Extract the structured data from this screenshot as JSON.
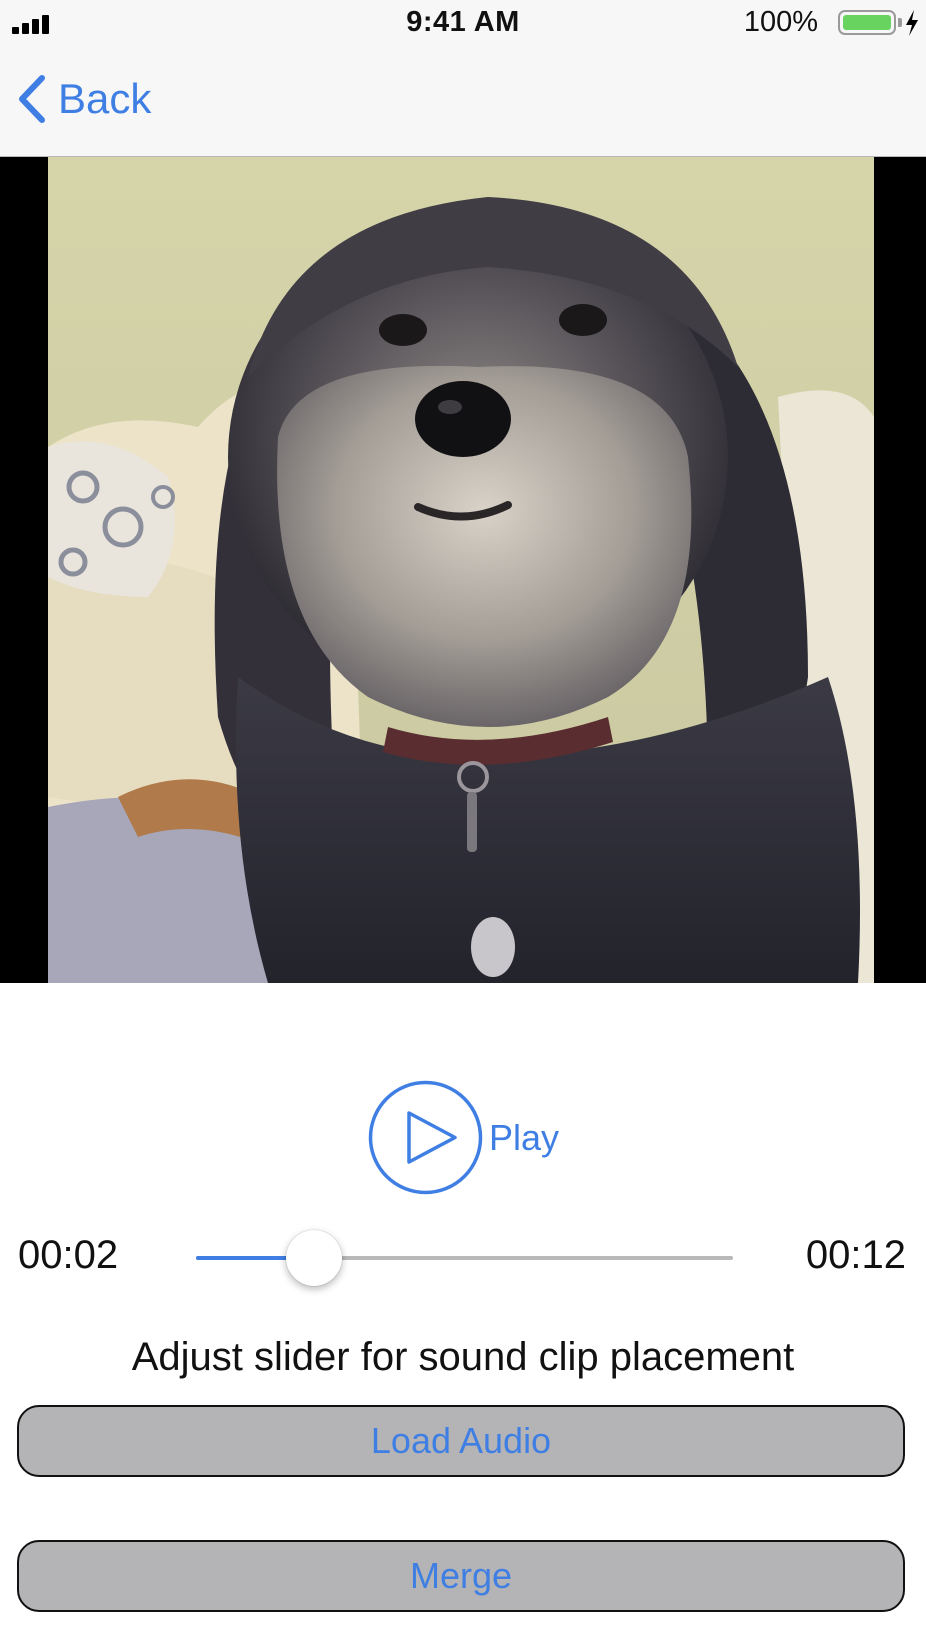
{
  "status_bar": {
    "time": "9:41 AM",
    "battery_percent": "100%",
    "battery_level": 1.0,
    "signal_bars": 4
  },
  "nav": {
    "back_label": "Back"
  },
  "video": {
    "content": "dog-video-frame"
  },
  "player": {
    "play_label": "Play",
    "current_time": "00:02",
    "total_time": "00:12",
    "slider_fraction": 0.22
  },
  "instruction": "Adjust slider for sound clip placement",
  "buttons": {
    "load_audio": "Load Audio",
    "merge": "Merge"
  },
  "colors": {
    "accent": "#3f7fe4",
    "button_bg": "#b4b4b6",
    "battery_fill": "#68d35f"
  }
}
